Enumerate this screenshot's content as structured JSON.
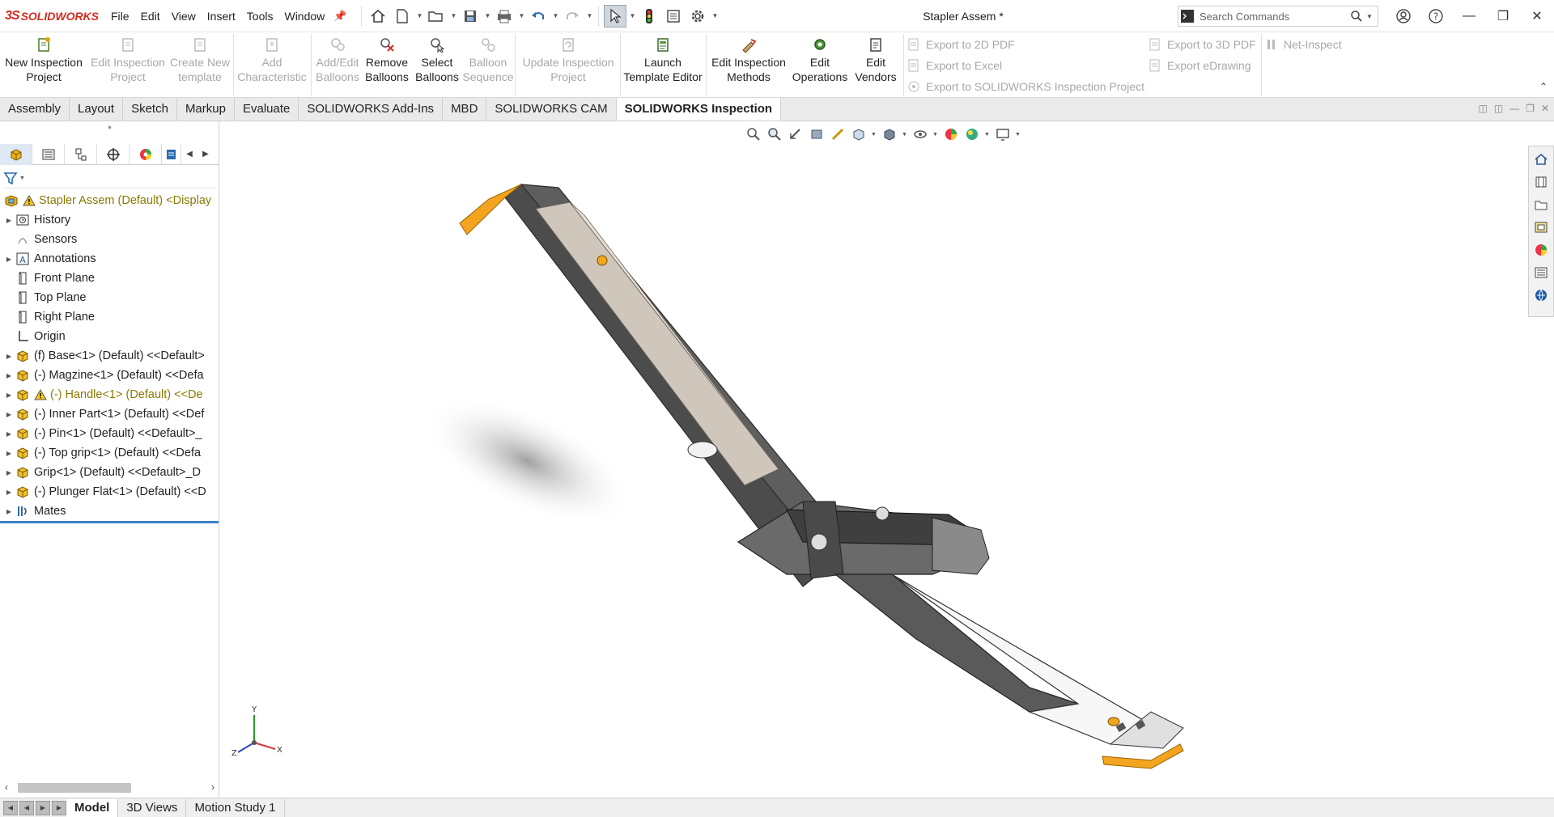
{
  "app": {
    "logo_mark": "3S",
    "logo_text": "SOLIDWORKS",
    "document_title": "Stapler Assem *"
  },
  "menu": [
    "File",
    "Edit",
    "View",
    "Insert",
    "Tools",
    "Window"
  ],
  "search": {
    "placeholder": "Search Commands"
  },
  "ribbon": {
    "buttons": [
      {
        "label": "New Inspection\nProject",
        "enabled": true
      },
      {
        "label": "Edit Inspection\nProject",
        "enabled": false
      },
      {
        "label": "Create New\ntemplate",
        "enabled": false
      },
      {
        "label": "Add\nCharacteristic",
        "enabled": false
      },
      {
        "label": "Add/Edit\nBalloons",
        "enabled": false
      },
      {
        "label": "Remove\nBalloons",
        "enabled": true
      },
      {
        "label": "Select\nBalloons",
        "enabled": true
      },
      {
        "label": "Balloon\nSequence",
        "enabled": false
      },
      {
        "label": "Update Inspection\nProject",
        "enabled": false
      },
      {
        "label": "Launch\nTemplate Editor",
        "enabled": true
      },
      {
        "label": "Edit Inspection\nMethods",
        "enabled": true
      },
      {
        "label": "Edit\nOperations",
        "enabled": true
      },
      {
        "label": "Edit\nVendors",
        "enabled": true
      }
    ],
    "export_items": [
      "Export to 2D PDF",
      "Export to Excel",
      "Export to SOLIDWORKS Inspection Project",
      "Export to 3D PDF",
      "Export eDrawing",
      "Net-Inspect"
    ]
  },
  "tabs": [
    "Assembly",
    "Layout",
    "Sketch",
    "Markup",
    "Evaluate",
    "SOLIDWORKS Add-Ins",
    "MBD",
    "SOLIDWORKS CAM",
    "SOLIDWORKS Inspection"
  ],
  "active_tab": "SOLIDWORKS Inspection",
  "tree": {
    "root": "Stapler Assem (Default) <Display",
    "items": [
      {
        "label": "History"
      },
      {
        "label": "Sensors"
      },
      {
        "label": "Annotations"
      },
      {
        "label": "Front Plane"
      },
      {
        "label": "Top Plane"
      },
      {
        "label": "Right Plane"
      },
      {
        "label": "Origin"
      },
      {
        "label": "(f) Base<1> (Default) <<Default>"
      },
      {
        "label": "(-) Magzine<1> (Default) <<Defa"
      },
      {
        "label": "(-) Handle<1> (Default) <<De"
      },
      {
        "label": "(-) Inner Part<1> (Default) <<Def"
      },
      {
        "label": "(-) Pin<1> (Default) <<Default>_"
      },
      {
        "label": "(-) Top grip<1> (Default) <<Defa"
      },
      {
        "label": "Grip<1> (Default) <<Default>_D"
      },
      {
        "label": "(-) Plunger Flat<1> (Default) <<D"
      },
      {
        "label": "Mates"
      }
    ]
  },
  "triad": {
    "y": "Y",
    "x": "X",
    "z": "Z"
  },
  "bottom_tabs": [
    "Model",
    "3D Views",
    "Motion Study 1"
  ],
  "colors": {
    "accent_orange": "#f3a51f",
    "tree_highlight": "#3b82c4",
    "warning": "#e6b800"
  }
}
